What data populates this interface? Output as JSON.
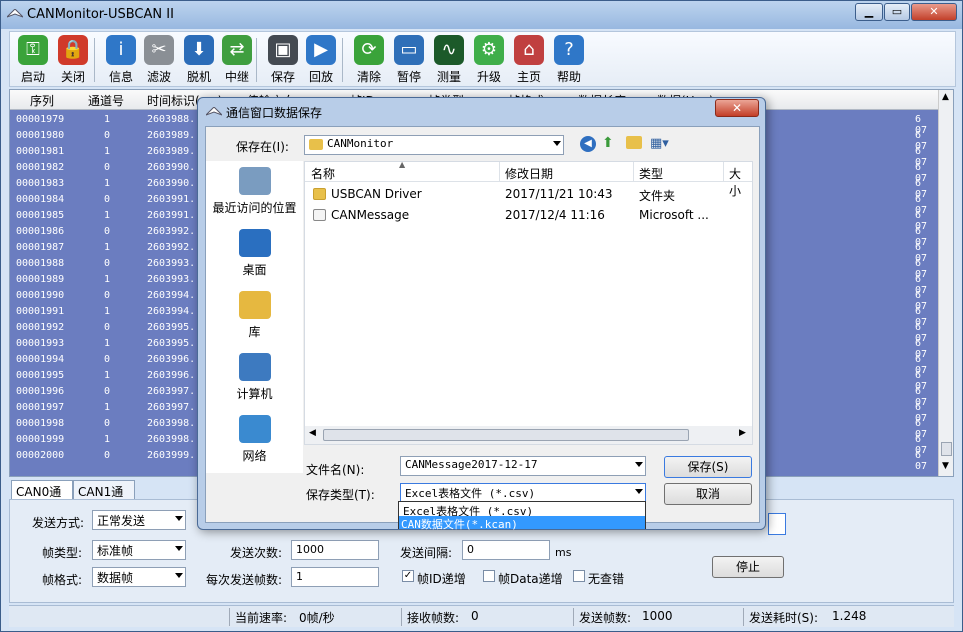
{
  "app": {
    "title": "CANMonitor-USBCAN II",
    "window_buttons": [
      "▁",
      "▭",
      "✕"
    ]
  },
  "toolbar": [
    {
      "label": "启动",
      "icon": "start-icon",
      "color": "#3aa33a"
    },
    {
      "label": "关闭",
      "icon": "close-device-icon",
      "color": "#d03a2a"
    },
    {
      "label": "信息",
      "icon": "info-icon",
      "color": "#2f77c8"
    },
    {
      "label": "滤波",
      "icon": "filter-icon",
      "color": "#8a8f95"
    },
    {
      "label": "脱机",
      "icon": "offline-icon",
      "color": "#2b6cb8"
    },
    {
      "label": "中继",
      "icon": "relay-icon",
      "color": "#3f9e3f"
    },
    {
      "label": "保存",
      "icon": "save-icon",
      "color": "#444a52"
    },
    {
      "label": "回放",
      "icon": "playback-icon",
      "color": "#2f77c8"
    },
    {
      "label": "清除",
      "icon": "clear-icon",
      "color": "#3aa33a"
    },
    {
      "label": "暂停",
      "icon": "pause-icon",
      "color": "#2f6fb8"
    },
    {
      "label": "测量",
      "icon": "measure-icon",
      "color": "#1c5a2a"
    },
    {
      "label": "升级",
      "icon": "upgrade-icon",
      "color": "#3fae4a"
    },
    {
      "label": "主页",
      "icon": "home-icon",
      "color": "#c04040"
    },
    {
      "label": "帮助",
      "icon": "help-icon",
      "color": "#2f77c8"
    }
  ],
  "grid": {
    "headers": [
      "序列",
      "通道号",
      "时间标识(ms)",
      "传输方向",
      "帧ID",
      "帧类型",
      "帧格式",
      "数据长度",
      "数据(Hex)"
    ],
    "rows": [
      [
        "00001979",
        "1",
        "2603988.",
        "6  07"
      ],
      [
        "00001980",
        "0",
        "2603989.",
        "6  07"
      ],
      [
        "00001981",
        "1",
        "2603989.",
        "6  07"
      ],
      [
        "00001982",
        "0",
        "2603990.",
        "6  07"
      ],
      [
        "00001983",
        "1",
        "2603990.",
        "6  07"
      ],
      [
        "00001984",
        "0",
        "2603991.",
        "6  07"
      ],
      [
        "00001985",
        "1",
        "2603991.",
        "6  07"
      ],
      [
        "00001986",
        "0",
        "2603992.",
        "6  07"
      ],
      [
        "00001987",
        "1",
        "2603992.",
        "6  07"
      ],
      [
        "00001988",
        "0",
        "2603993.",
        "6  07"
      ],
      [
        "00001989",
        "1",
        "2603993.",
        "6  07"
      ],
      [
        "00001990",
        "0",
        "2603994.",
        "6  07"
      ],
      [
        "00001991",
        "1",
        "2603994.",
        "6  07"
      ],
      [
        "00001992",
        "0",
        "2603995.",
        "6  07"
      ],
      [
        "00001993",
        "1",
        "2603995.",
        "6  07"
      ],
      [
        "00001994",
        "0",
        "2603996.",
        "6  07"
      ],
      [
        "00001995",
        "1",
        "2603996.",
        "6  07"
      ],
      [
        "00001996",
        "0",
        "2603997.",
        "6  07"
      ],
      [
        "00001997",
        "1",
        "2603997.",
        "6  07"
      ],
      [
        "00001998",
        "0",
        "2603998.",
        "6  07"
      ],
      [
        "00001999",
        "1",
        "2603998.",
        "6  07"
      ],
      [
        "00002000",
        "0",
        "2603999.",
        "6  07"
      ]
    ]
  },
  "tabs": [
    "CAN0通道",
    "CAN1通道"
  ],
  "send_panel": {
    "send_mode_label": "发送方式:",
    "send_mode_value": "正常发送",
    "frame_type_label": "帧类型:",
    "frame_type_value": "标准帧",
    "frame_format_label": "帧格式:",
    "frame_format_value": "数据帧",
    "send_count_label": "发送次数:",
    "send_count_value": "1000",
    "interval_label": "发送间隔:",
    "interval_value": "0",
    "interval_unit": "ms",
    "frames_per_send_label": "每次发送帧数:",
    "frames_per_send_value": "1",
    "chk_id_inc": "帧ID递增",
    "chk_id_inc_checked": "✓",
    "chk_data_inc": "帧Data递增",
    "chk_no_error": "无查错",
    "stop_button": "停止"
  },
  "status": {
    "rate_label": "当前速率:",
    "rate_value": "0帧/秒",
    "recv_label": "接收帧数:",
    "recv_value": "0",
    "sent_label": "发送帧数:",
    "sent_value": "1000",
    "time_label": "发送耗时(S):",
    "time_value": "1.248"
  },
  "dialog": {
    "title": "通信窗口数据保存",
    "close": "✕",
    "save_in_label": "保存在(I):",
    "save_in_value": "CANMonitor",
    "places": [
      {
        "label": "最近访问的位置",
        "icon": "recent-places-icon",
        "color": "#7a9cc0"
      },
      {
        "label": "桌面",
        "icon": "desktop-icon",
        "color": "#2a6fc0"
      },
      {
        "label": "库",
        "icon": "library-icon",
        "color": "#e6b840"
      },
      {
        "label": "计算机",
        "icon": "computer-icon",
        "color": "#3d7ac0"
      },
      {
        "label": "网络",
        "icon": "network-icon",
        "color": "#3a8ad0"
      }
    ],
    "columns": [
      "名称",
      "修改日期",
      "类型",
      "大小"
    ],
    "files": [
      {
        "name": "USBCAN Driver",
        "date": "2017/11/21 10:43",
        "type": "文件夹",
        "icon": "folder-icon"
      },
      {
        "name": "CANMessage",
        "date": "2017/12/4 11:16",
        "type": "Microsoft ...",
        "icon": "file-icon"
      }
    ],
    "filename_label": "文件名(N):",
    "filename_value": "CANMessage2017-12-17",
    "filetype_label": "保存类型(T):",
    "filetype_value": "Excel表格文件 (*.csv)",
    "filetype_options": [
      "Excel表格文件 (*.csv)",
      "CAN数据文件(*.kcan)"
    ],
    "save_button": "保存(S)",
    "cancel_button": "取消"
  }
}
